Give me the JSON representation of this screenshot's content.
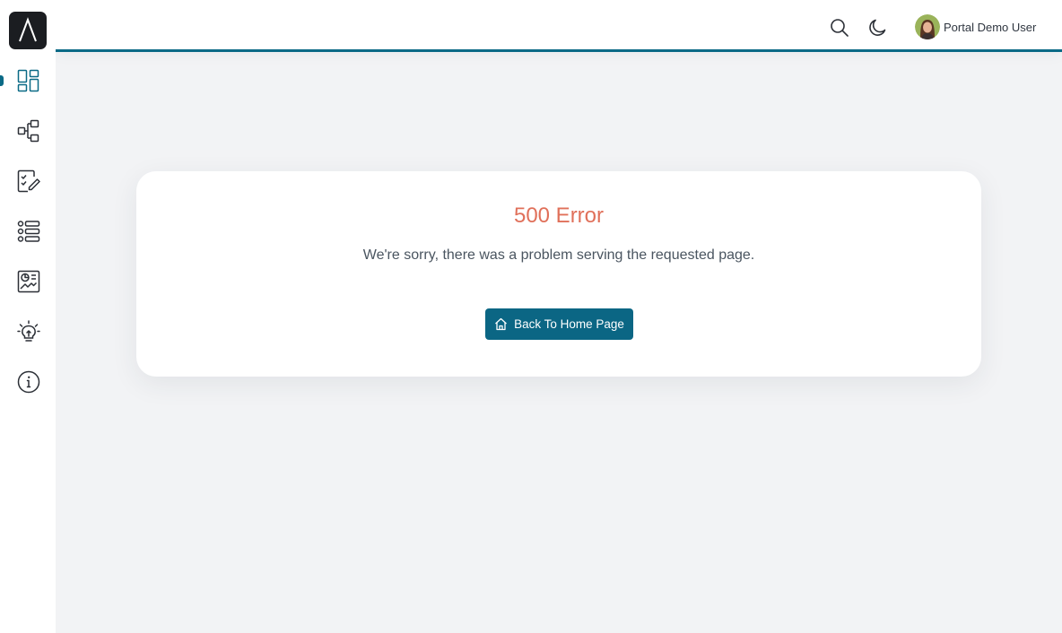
{
  "header": {
    "user_name": "Portal Demo User"
  },
  "error": {
    "title": "500 Error",
    "message": "We're sorry, there was a problem serving the requested page.",
    "button_label": "Back To Home Page"
  },
  "colors": {
    "accent": "#0a6a86",
    "error": "#e0705a",
    "sidebar_icon": "#2b2f36"
  },
  "sidebar": {
    "items": [
      {
        "icon": "dashboard-icon",
        "active": true
      },
      {
        "icon": "workflow-icon",
        "active": false
      },
      {
        "icon": "checklist-edit-icon",
        "active": false
      },
      {
        "icon": "list-icon",
        "active": false
      },
      {
        "icon": "report-icon",
        "active": false
      },
      {
        "icon": "lightbulb-icon",
        "active": false
      },
      {
        "icon": "info-icon",
        "active": false
      }
    ]
  }
}
